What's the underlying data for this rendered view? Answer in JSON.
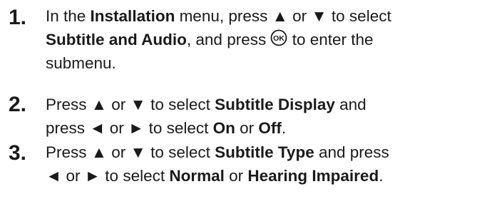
{
  "steps": [
    {
      "number": "1.",
      "line1": {
        "t1": "In the ",
        "b1": "Installation",
        "t2": " menu, press ▲ or ▼ to select"
      },
      "line2": {
        "b1": "Subtitle and Audio",
        "t1": ", and press ",
        "ok_icon": "ok-button-icon",
        "ok_label": "OK",
        "t2": " to enter the"
      },
      "line3": {
        "t1": "submenu."
      }
    },
    {
      "number": "2.",
      "line1": {
        "t1": "Press ▲ or ▼ to select ",
        "b1": "Subtitle Display",
        "t2": " and"
      },
      "line2": {
        "t1": "press ◄ or ► to select ",
        "b1": "On",
        "t2": " or ",
        "b2": "Off",
        "t3": "."
      }
    },
    {
      "number": "3.",
      "line1": {
        "t1": "Press ▲ or ▼ to select ",
        "b1": "Subtitle Type",
        "t2": " and press"
      },
      "line2": {
        "t1": "◄ or ► to select ",
        "b1": "Normal",
        "t2": " or ",
        "b2": "Hearing Impaired",
        "t3": "."
      }
    }
  ]
}
